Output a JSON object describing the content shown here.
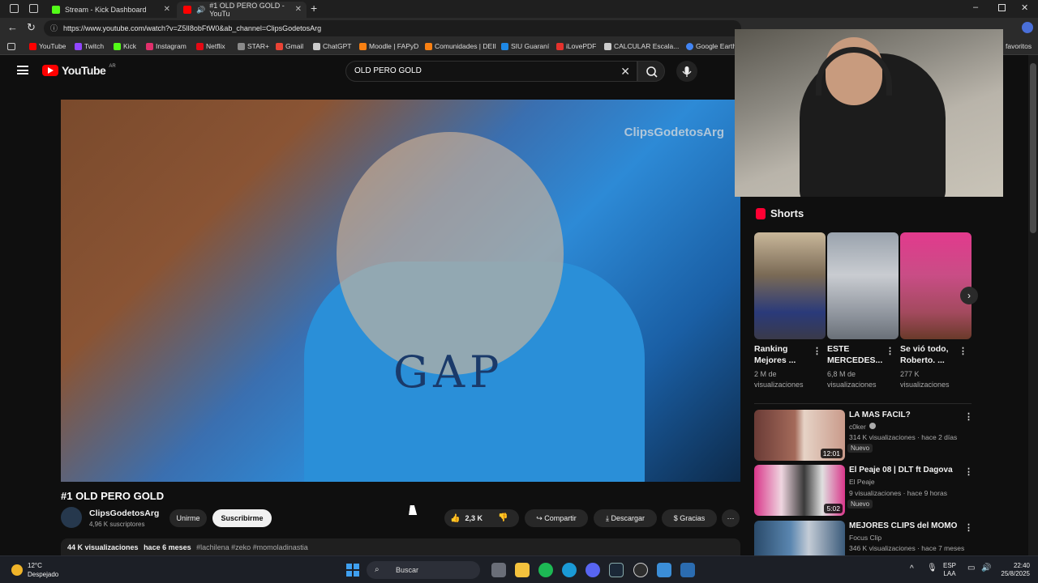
{
  "browser": {
    "tabs": [
      {
        "label": "Stream - Kick Dashboard",
        "icon": "kick-icon",
        "color": "#53fc18"
      },
      {
        "label": "#1 OLD PERO GOLD - YouTu",
        "icon": "youtube-icon",
        "color": "#ff0000"
      }
    ],
    "url": "https://www.youtube.com/watch?v=Z5lI8obFtW0&ab_channel=ClipsGodetosArg",
    "bookmarks": [
      {
        "label": "YouTube",
        "color": "#ff0000"
      },
      {
        "label": "Twitch",
        "color": "#9146ff"
      },
      {
        "label": "Kick",
        "color": "#53fc18"
      },
      {
        "label": "Instagram",
        "color": "#e1306c"
      },
      {
        "label": "Netflix",
        "color": "#e50914"
      },
      {
        "label": "STAR+",
        "color": "#8a8a8a"
      },
      {
        "label": "Gmail",
        "color": "#ea4335"
      },
      {
        "label": "ChatGPT",
        "color": "#cccccc"
      },
      {
        "label": "Moodle | FAPyD",
        "color": "#f98012"
      },
      {
        "label": "Comunidades | DEII",
        "color": "#f98012"
      },
      {
        "label": "SIU Guaraní",
        "color": "#1e88e5"
      },
      {
        "label": "iLovePDF",
        "color": "#e5322d"
      },
      {
        "label": "CALCULAR Escala...",
        "color": "#cccccc"
      },
      {
        "label": "Google Earth",
        "color": "#4285f4"
      }
    ],
    "all_bookmarks": "favoritos"
  },
  "youtube": {
    "logo": "YouTube",
    "region": "AR",
    "search_value": "OLD PERO GOLD",
    "video": {
      "watermark": "ClipsGodetosArg",
      "title": "#1 OLD PERO GOLD",
      "channel": "ClipsGodetosArg",
      "subscribers": "4,96 K suscriptores",
      "join_label": "Unirme",
      "subscribe_label": "Suscribirme",
      "likes": "2,3 K",
      "share_label": "Compartir",
      "download_label": "Descargar",
      "thanks_label": "Gracias",
      "views": "44 K visualizaciones",
      "age": "hace 6 meses",
      "tags": "#lachilena #zeko #momoladinastia"
    },
    "shorts": {
      "title": "Shorts",
      "items": [
        {
          "title": "Ranking Mejores ...",
          "meta": "2 M de visualizaciones"
        },
        {
          "title": "ESTE MERCEDES...",
          "meta": "6,8 M de visualizaciones"
        },
        {
          "title": "Se vió todo, Roberto. ...",
          "meta": "277 K visualizaciones"
        }
      ]
    },
    "recommended": [
      {
        "title": "LA MAS FACIL?",
        "channel": "c0ker",
        "meta": "314 K visualizaciones · hace 2 días",
        "badge": "Nuevo",
        "duration": "12:01"
      },
      {
        "title": "El Peaje 08 | DLT ft Dagova",
        "channel": "El Peaje",
        "meta": "9 visualizaciones · hace 9 horas",
        "badge": "Nuevo",
        "duration": "5:02"
      },
      {
        "title": "MEJORES CLIPS del MOMO",
        "channel": "Focus Clip",
        "meta": "346 K visualizaciones · hace 7 meses",
        "badge": "",
        "duration": ""
      }
    ]
  },
  "taskbar": {
    "weather_temp": "12°C",
    "weather_desc": "Despejado",
    "search_placeholder": "Buscar",
    "lang": "ESP",
    "lang2": "LAA",
    "time": "22:40",
    "date": "25/8/2025"
  }
}
